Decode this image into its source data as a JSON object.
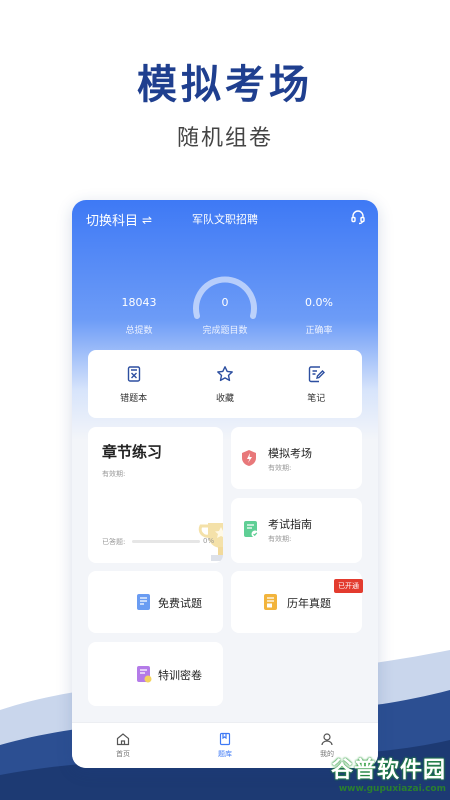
{
  "hero": {
    "title": "模拟考场",
    "subtitle": "随机组卷"
  },
  "topbar": {
    "switch_label": "切换科目",
    "swap_icon": "⇌",
    "subject": "军队文职招聘"
  },
  "stats": [
    {
      "value": "18043",
      "label": "总提数"
    },
    {
      "value": "0",
      "label": "完成题目数"
    },
    {
      "value": "0.0%",
      "label": "正确率"
    }
  ],
  "quick": [
    {
      "label": "错题本",
      "icon": "wrong-book-icon"
    },
    {
      "label": "收藏",
      "icon": "star-icon"
    },
    {
      "label": "笔记",
      "icon": "note-icon"
    }
  ],
  "chapter": {
    "title": "章节练习",
    "valid": "有效期:",
    "done": "已答题:",
    "percent": "0%",
    "progress": 0
  },
  "mock": {
    "label": "模拟考场",
    "valid": "有效期:"
  },
  "guide": {
    "label": "考试指南",
    "valid": "有效期:"
  },
  "free": {
    "label": "免费试题"
  },
  "past": {
    "label": "历年真题",
    "badge": "已开通"
  },
  "secret": {
    "label": "特训密卷"
  },
  "nav": [
    {
      "label": "首页",
      "icon": "home-icon"
    },
    {
      "label": "题库",
      "icon": "question-bank-icon"
    },
    {
      "label": "我的",
      "icon": "profile-icon"
    }
  ],
  "watermark": {
    "main": "谷普软件园",
    "url": "www.gupuxiazai.com"
  },
  "colors": {
    "brand": "#3e79f5",
    "title": "#1f3f8f",
    "badge": "#e33b2e"
  }
}
